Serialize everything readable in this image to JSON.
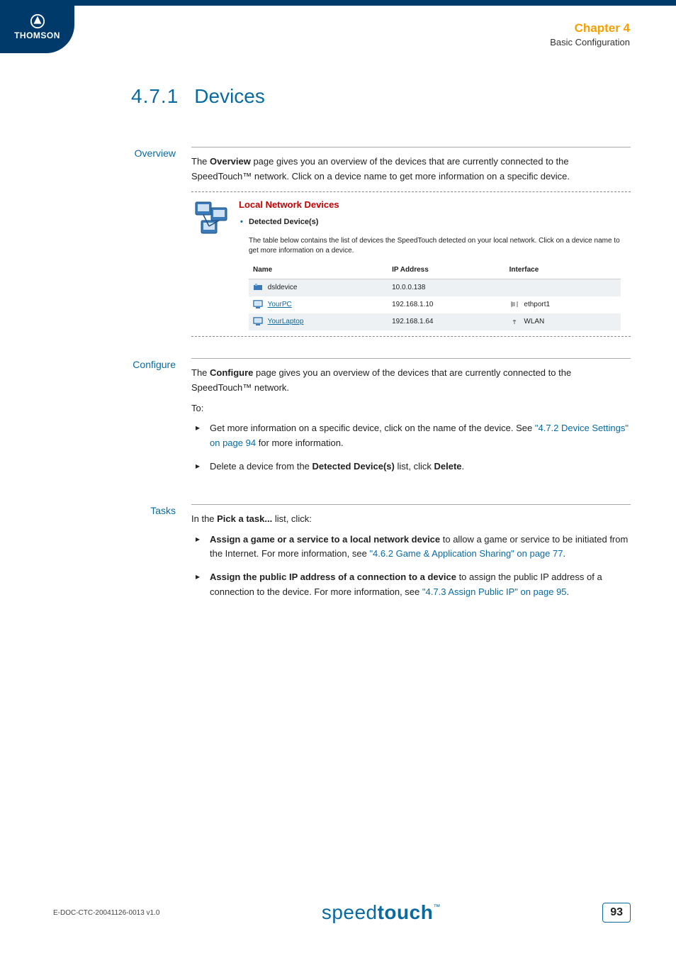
{
  "header": {
    "brand": "THOMSON",
    "chapter_label": "Chapter 4",
    "chapter_sub": "Basic Configuration"
  },
  "title": {
    "number": "4.7.1",
    "text": "Devices"
  },
  "overview": {
    "label": "Overview",
    "p1_a": "The ",
    "p1_b": "Overview",
    "p1_c": " page gives you an overview of the devices that are currently connected to the SpeedTouch™ network. Click on a device name to get more information on a specific device.",
    "panel": {
      "title": "Local Network Devices",
      "subtitle": "Detected Device(s)",
      "note": "The table below contains the list of devices the SpeedTouch detected on your local network. Click on a device name to get more information on a device.",
      "cols": {
        "name": "Name",
        "ip": "IP Address",
        "iface": "Interface"
      },
      "rows": [
        {
          "name": "dsldevice",
          "ip": "10.0.0.138",
          "iface": "",
          "link": false,
          "icon": "modem"
        },
        {
          "name": "YourPC",
          "ip": "192.168.1.10",
          "iface": "ethport1",
          "link": true,
          "icon": "pc"
        },
        {
          "name": "YourLaptop",
          "ip": "192.168.1.64",
          "iface": "WLAN",
          "link": true,
          "icon": "pc"
        }
      ]
    }
  },
  "configure": {
    "label": "Configure",
    "p1_a": "The ",
    "p1_b": "Configure",
    "p1_c": " page gives you an overview of the devices that are currently connected to the SpeedTouch™ network.",
    "to_label": "To:",
    "b1_a": "Get more information on a specific device, click on the name of the device. See ",
    "b1_link": "\"4.7.2 Device Settings\" on page 94",
    "b1_b": " for more information.",
    "b2_a": "Delete a device from the ",
    "b2_bold": "Detected Device(s)",
    "b2_b": " list, click ",
    "b2_bold2": "Delete",
    "b2_c": "."
  },
  "tasks": {
    "label": "Tasks",
    "intro_a": "In the ",
    "intro_bold": "Pick a task...",
    "intro_b": " list, click:",
    "b1_bold": "Assign a game or a service to a local network device",
    "b1_a": " to allow a game or service to be initiated from the Internet. For more information, see ",
    "b1_link": "\"4.6.2 Game & Application Sharing\" on page 77",
    "b1_b": ".",
    "b2_bold": "Assign the public IP address of a connection to a device",
    "b2_a": " to assign the public IP address of a connection to the device. For more information, see ",
    "b2_link": "\"4.7.3 Assign Public IP\" on page 95",
    "b2_b": "."
  },
  "footer": {
    "docid": "E-DOC-CTC-20041126-0013 v1.0",
    "product_light": "speed",
    "product_bold": "touch",
    "tm": "™",
    "page": "93"
  }
}
